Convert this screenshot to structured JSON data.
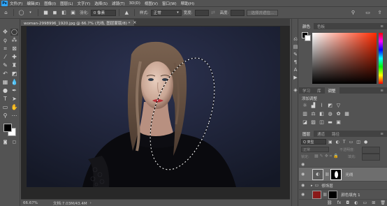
{
  "app": {
    "logo": "Ps"
  },
  "menu": [
    "文件(F)",
    "编辑(E)",
    "图像(I)",
    "图层(L)",
    "文字(Y)",
    "选择(S)",
    "滤镜(T)",
    "3D(D)",
    "视图(V)",
    "窗口(W)",
    "帮助(H)"
  ],
  "options": {
    "feather_label": "羽化:",
    "feather_value": "0 像素",
    "style_label": "样式:",
    "style_value": "正常",
    "width_label": "宽度:",
    "height_label": "高度:",
    "select_mask_button": "选择并遮住..."
  },
  "document": {
    "tab_title": "woman-2998996_1920.jpg @ 66.7% (光线, 图层蒙版/8) *",
    "zoom": "66.67%",
    "doc_size": "文档:7.03M/43.4M"
  },
  "panels": {
    "color_tabs": [
      "颜色",
      "色板"
    ],
    "adj_tabs": [
      "学习",
      "库",
      "调整"
    ],
    "adj_title": "添加调整",
    "layers_tabs": [
      "图层",
      "通道",
      "路径"
    ],
    "kind_filter": "Q 类型",
    "blend_mode": "正常",
    "opacity_label": "不透明度:",
    "lock_label": "锁定:",
    "fill_label": "填充:"
  },
  "layers": [
    {
      "name": "光线",
      "selected": true
    },
    {
      "name": "修饰层",
      "selected": false
    },
    {
      "name": "颜色填充 1",
      "selected": false
    }
  ],
  "colors": {
    "accent": "#31a8ff",
    "panel": "#535353",
    "dark": "#424242"
  }
}
